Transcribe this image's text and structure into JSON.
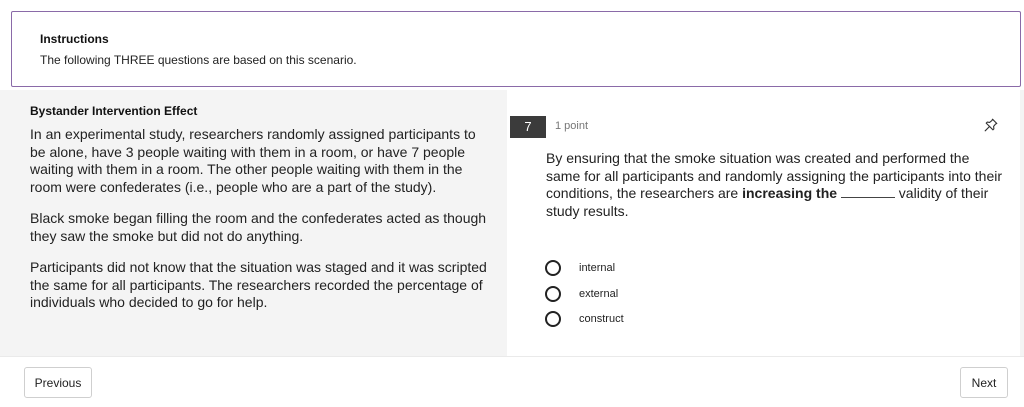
{
  "instructions": {
    "title": "Instructions",
    "text": "The following THREE questions are based on this scenario."
  },
  "scenario": {
    "title": "Bystander Intervention Effect",
    "paragraphs": [
      "In an experimental study, researchers randomly assigned participants to be alone, have 3 people waiting with them in a room, or have 7 people waiting with them in a room. The other people waiting with them in the room were confederates (i.e., people who are a part of the study).",
      "Black smoke  began filling the room and the confederates acted as though they saw the smoke but did not do anything.",
      "Participants did not know that the situation was staged and it was scripted the same for all participants. The researchers recorded the percentage of individuals who decided to go for help."
    ]
  },
  "question": {
    "number": "7",
    "points": "1 point",
    "text_before": "By ensuring that the smoke situation was created and performed the same for all participants and randomly assigning the participants into their conditions, the researchers are ",
    "text_bold": "increasing the",
    "text_after": " validity of their study results.",
    "options": [
      "internal",
      "external",
      "construct"
    ],
    "pin_icon": "pin-icon"
  },
  "nav": {
    "previous_label": "Previous",
    "next_label": "Next"
  }
}
